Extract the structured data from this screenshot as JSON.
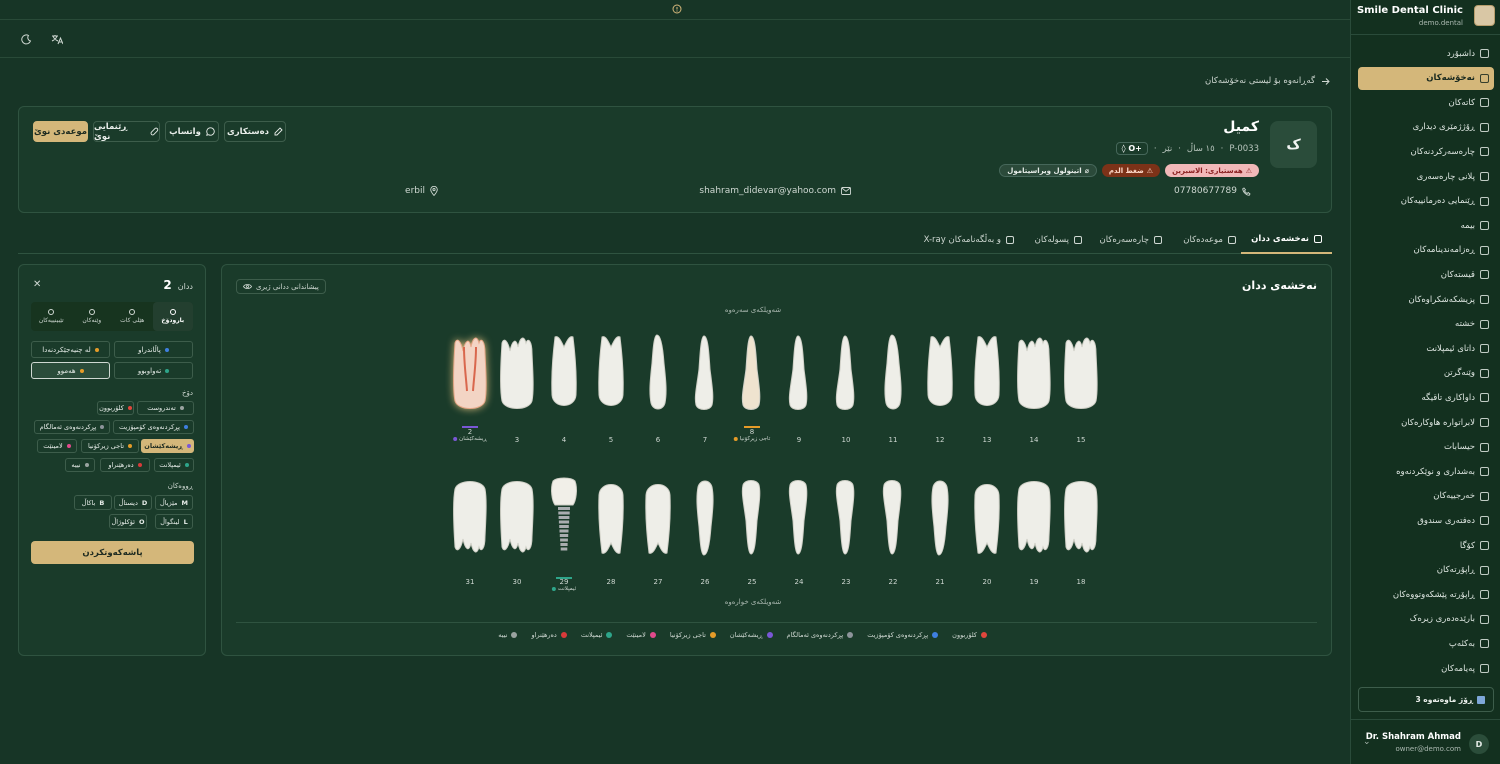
{
  "sidebar": {
    "brand_name": "Smile Dental Clinic",
    "brand_sub": "demo.dental",
    "items": [
      {
        "label": "داشبۆرد"
      },
      {
        "label": "نەخۆشەکان",
        "active": true
      },
      {
        "label": "کاتەکان"
      },
      {
        "label": "ڕۆژژمێری دیداری"
      },
      {
        "label": "چارەسەرکردنەکان"
      },
      {
        "label": "پلانی چارەسەری"
      },
      {
        "label": "ڕێنمایی دەرمانییەکان"
      },
      {
        "label": "بیمە"
      },
      {
        "label": "ڕەزامەندینامەکان"
      },
      {
        "label": "قیستەکان"
      },
      {
        "label": "پزیشکەشکراوەکان"
      },
      {
        "label": "خشتە"
      },
      {
        "label": "داتای ئیمپلانت"
      },
      {
        "label": "وێنەگرتن"
      },
      {
        "label": "داواکاری تاقیگە"
      },
      {
        "label": "لابراتواره هاوکارەکان"
      },
      {
        "label": "حیسابات"
      },
      {
        "label": "بەشداری و نوێکردنەوە"
      },
      {
        "label": "خەرجییەکان"
      },
      {
        "label": "دەفتەری سندوق"
      },
      {
        "label": "کۆگا"
      },
      {
        "label": "ڕاپۆرتەکان"
      },
      {
        "label": "ڕاپۆرتە پێشکەوتووەکان"
      },
      {
        "label": "بارێدەدەری زیرەک"
      },
      {
        "label": "بەکئەپ"
      },
      {
        "label": "پەیامەکان"
      }
    ],
    "trial": "3 ڕۆژ ماوەتەوە",
    "user_name": "Dr. Shahram Ahmad",
    "user_email": "owner@demo.com",
    "user_initial": "D"
  },
  "back_link": "گەڕانەوە بۆ لیستی نەخۆشەکان",
  "patient": {
    "initial": "ک",
    "name": "کمیل",
    "id": "P-0033",
    "age": "١٥ ساڵ",
    "gender": "نێر",
    "blood": "O+",
    "tags": [
      {
        "type": "allergy",
        "label": "هەستیاری: الاسبرین"
      },
      {
        "type": "cond",
        "label": "ضغط الدم"
      },
      {
        "type": "med",
        "label": "اتینولول ویراسیتامول"
      }
    ],
    "phone": "07780677789",
    "email": "shahram_didevar@yahoo.com",
    "city": "erbil",
    "buttons": {
      "edit": "دەستکاری",
      "whatsapp": "واتساپ",
      "guide": "ڕێنمایی نوێ",
      "new_appt": "موعەدی نوێ"
    }
  },
  "tabs": [
    {
      "label": "نەخشەی ددان",
      "active": true
    },
    {
      "label": "موعەدەکان"
    },
    {
      "label": "چارەسەرەکان"
    },
    {
      "label": "پسولەکان"
    },
    {
      "label": "X-ray و بەڵگەنامەکان"
    }
  ],
  "chart": {
    "title": "نەخشەی ددان",
    "primary_toggle": "پیشاندانی ددانی ژیری",
    "upper_label": "شەویلکەی سەرەوە",
    "lower_label": "شەویلکەی خوارەوە",
    "upper_teeth": [
      {
        "num": "2",
        "selected": true,
        "cond": "ڕیشەکێشان",
        "cond_color": "#7a57d6"
      },
      {
        "num": "3"
      },
      {
        "num": "4"
      },
      {
        "num": "5"
      },
      {
        "num": "6"
      },
      {
        "num": "7"
      },
      {
        "num": "8",
        "cond": "تاجی زیرکۆنیا",
        "cond_color": "#e59b28"
      },
      {
        "num": "9"
      },
      {
        "num": "10"
      },
      {
        "num": "11"
      },
      {
        "num": "12"
      },
      {
        "num": "13"
      },
      {
        "num": "14"
      },
      {
        "num": "15"
      }
    ],
    "lower_teeth": [
      {
        "num": "31"
      },
      {
        "num": "30"
      },
      {
        "num": "29",
        "cond": "ئیمپلانت",
        "cond_color": "#2ea58a"
      },
      {
        "num": "28"
      },
      {
        "num": "27"
      },
      {
        "num": "26"
      },
      {
        "num": "25"
      },
      {
        "num": "24"
      },
      {
        "num": "23"
      },
      {
        "num": "22"
      },
      {
        "num": "21"
      },
      {
        "num": "20"
      },
      {
        "num": "19"
      },
      {
        "num": "18"
      }
    ],
    "legend": [
      {
        "label": "کلۆربوون",
        "color": "#e0463c"
      },
      {
        "label": "پڕکردنەوەی کۆمپۆزیت",
        "color": "#3f7fe0"
      },
      {
        "label": "پڕکردنەوەی ئەمالگام",
        "color": "#8d949a"
      },
      {
        "label": "ڕیشەکێشان",
        "color": "#7a57d6"
      },
      {
        "label": "تاجی زیرکۆنیا",
        "color": "#e59b28"
      },
      {
        "label": "لامینێت",
        "color": "#e14a8c"
      },
      {
        "label": "ئیمپلانت",
        "color": "#2ea58a"
      },
      {
        "label": "دەرهێنراو",
        "color": "#d83a3a"
      },
      {
        "label": "نییە",
        "color": "#9aa3a0"
      }
    ]
  },
  "panel": {
    "label": "ددان",
    "number": "2",
    "tabs": [
      "بارودۆخ",
      "هێلی کات",
      "وێنەکان",
      "تێبینییەکان"
    ],
    "status": [
      "پاڵاندراو",
      "لە چنیەجێکردنەدا",
      "تەواوبوو",
      "هەموو"
    ],
    "condition_title": "دۆخ",
    "conditions": [
      {
        "label": "تەندروست",
        "color": "#9aa3a0"
      },
      {
        "label": "کلۆربوون",
        "color": "#e0463c"
      },
      {
        "label": "پڕکردنەوەی کۆمپۆزیت",
        "color": "#3f7fe0"
      },
      {
        "label": "پڕکردنەوەی ئەمالگام",
        "color": "#8d949a"
      },
      {
        "label": "ڕیشەکێشان",
        "color": "#7a57d6"
      },
      {
        "label": "تاجی زیرکۆنیا",
        "color": "#e59b28"
      },
      {
        "label": "لامینێت",
        "color": "#e14a8c"
      },
      {
        "label": "ئیمپلانت",
        "color": "#2ea58a"
      },
      {
        "label": "دەرهێنراو",
        "color": "#d83a3a"
      },
      {
        "label": "نییە",
        "color": "#9aa3a0"
      }
    ],
    "surfaces_title": "ڕووەکان",
    "surfaces": [
      {
        "code": "M",
        "label": "مێزیاڵ"
      },
      {
        "code": "D",
        "label": "دیستاڵ"
      },
      {
        "code": "B",
        "label": "باکاڵ"
      },
      {
        "code": "L",
        "label": "لینگواڵ"
      },
      {
        "code": "O",
        "label": "ئۆکلوژاڵ"
      }
    ],
    "save": "پاشەکەوتکردن"
  }
}
